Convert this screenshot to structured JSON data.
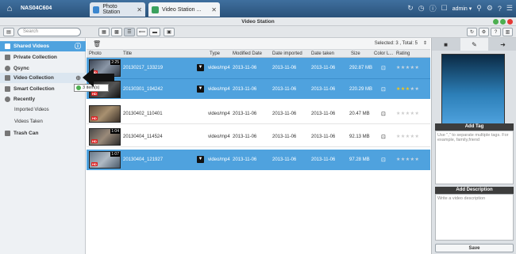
{
  "topbar": {
    "nas_name": "NAS04C604",
    "tabs": [
      {
        "label": "Photo Station",
        "close": "✕"
      },
      {
        "label": "Video Station ...",
        "close": "✕"
      }
    ],
    "user": "admin ▾"
  },
  "window": {
    "title": "Video Station"
  },
  "toolbar": {
    "search_placeholder": "Search"
  },
  "sidebar": {
    "shared": "Shared Videos",
    "private": "Private Collection",
    "qsync": "Qsync",
    "video_collection": "Video Collection",
    "smart": "Smart Collection",
    "recently": "Recently",
    "imported": "Imported Videos",
    "taken": "Videos Taken",
    "trash": "Trash Can"
  },
  "tooltip": {
    "text": "3 item(s)"
  },
  "selection": {
    "text": "Selected: 3 , Total: 5"
  },
  "columns": {
    "photo": "Photo",
    "title": "Title",
    "type": "Type",
    "modified": "Modified Date",
    "imported": "Date imported",
    "taken": "Date taken",
    "size": "Size",
    "color": "Color L...",
    "rating": "Rating"
  },
  "rows": [
    {
      "duration": "2:25",
      "title": "20130217_133219",
      "type": "video/mp4",
      "modified": "2013-11-06",
      "imported": "2013-11-06",
      "taken": "2013-11-06",
      "size": "292.87 MB",
      "hd": "HD"
    },
    {
      "duration": "",
      "title": "20130301_194242",
      "type": "video/mp4",
      "modified": "2013-11-06",
      "imported": "2013-11-06",
      "taken": "2013-11-06",
      "size": "220.29 MB",
      "hd": "HD"
    },
    {
      "duration": "",
      "title": "20130402_110401",
      "type": "video/mp4",
      "modified": "2013-11-06",
      "imported": "2013-11-06",
      "taken": "2013-11-06",
      "size": "20.47 MB",
      "hd": "HD"
    },
    {
      "duration": "1:04",
      "title": "20130404_114524",
      "type": "video/mp4",
      "modified": "2013-11-06",
      "imported": "2013-11-06",
      "taken": "2013-11-06",
      "size": "92.13 MB",
      "hd": "HD"
    },
    {
      "duration": "1:07",
      "title": "20130404_121927",
      "type": "video/mp4",
      "modified": "2013-11-06",
      "imported": "2013-11-06",
      "taken": "2013-11-06",
      "size": "97.28 MB",
      "hd": "HD"
    }
  ],
  "rightpanel": {
    "add_tag": "Add Tag",
    "tag_hint": "Use \",\" to separate multiple tags. For example, family,friend",
    "add_description": "Add Description",
    "desc_placeholder": "Write a video description",
    "save": "Save"
  }
}
